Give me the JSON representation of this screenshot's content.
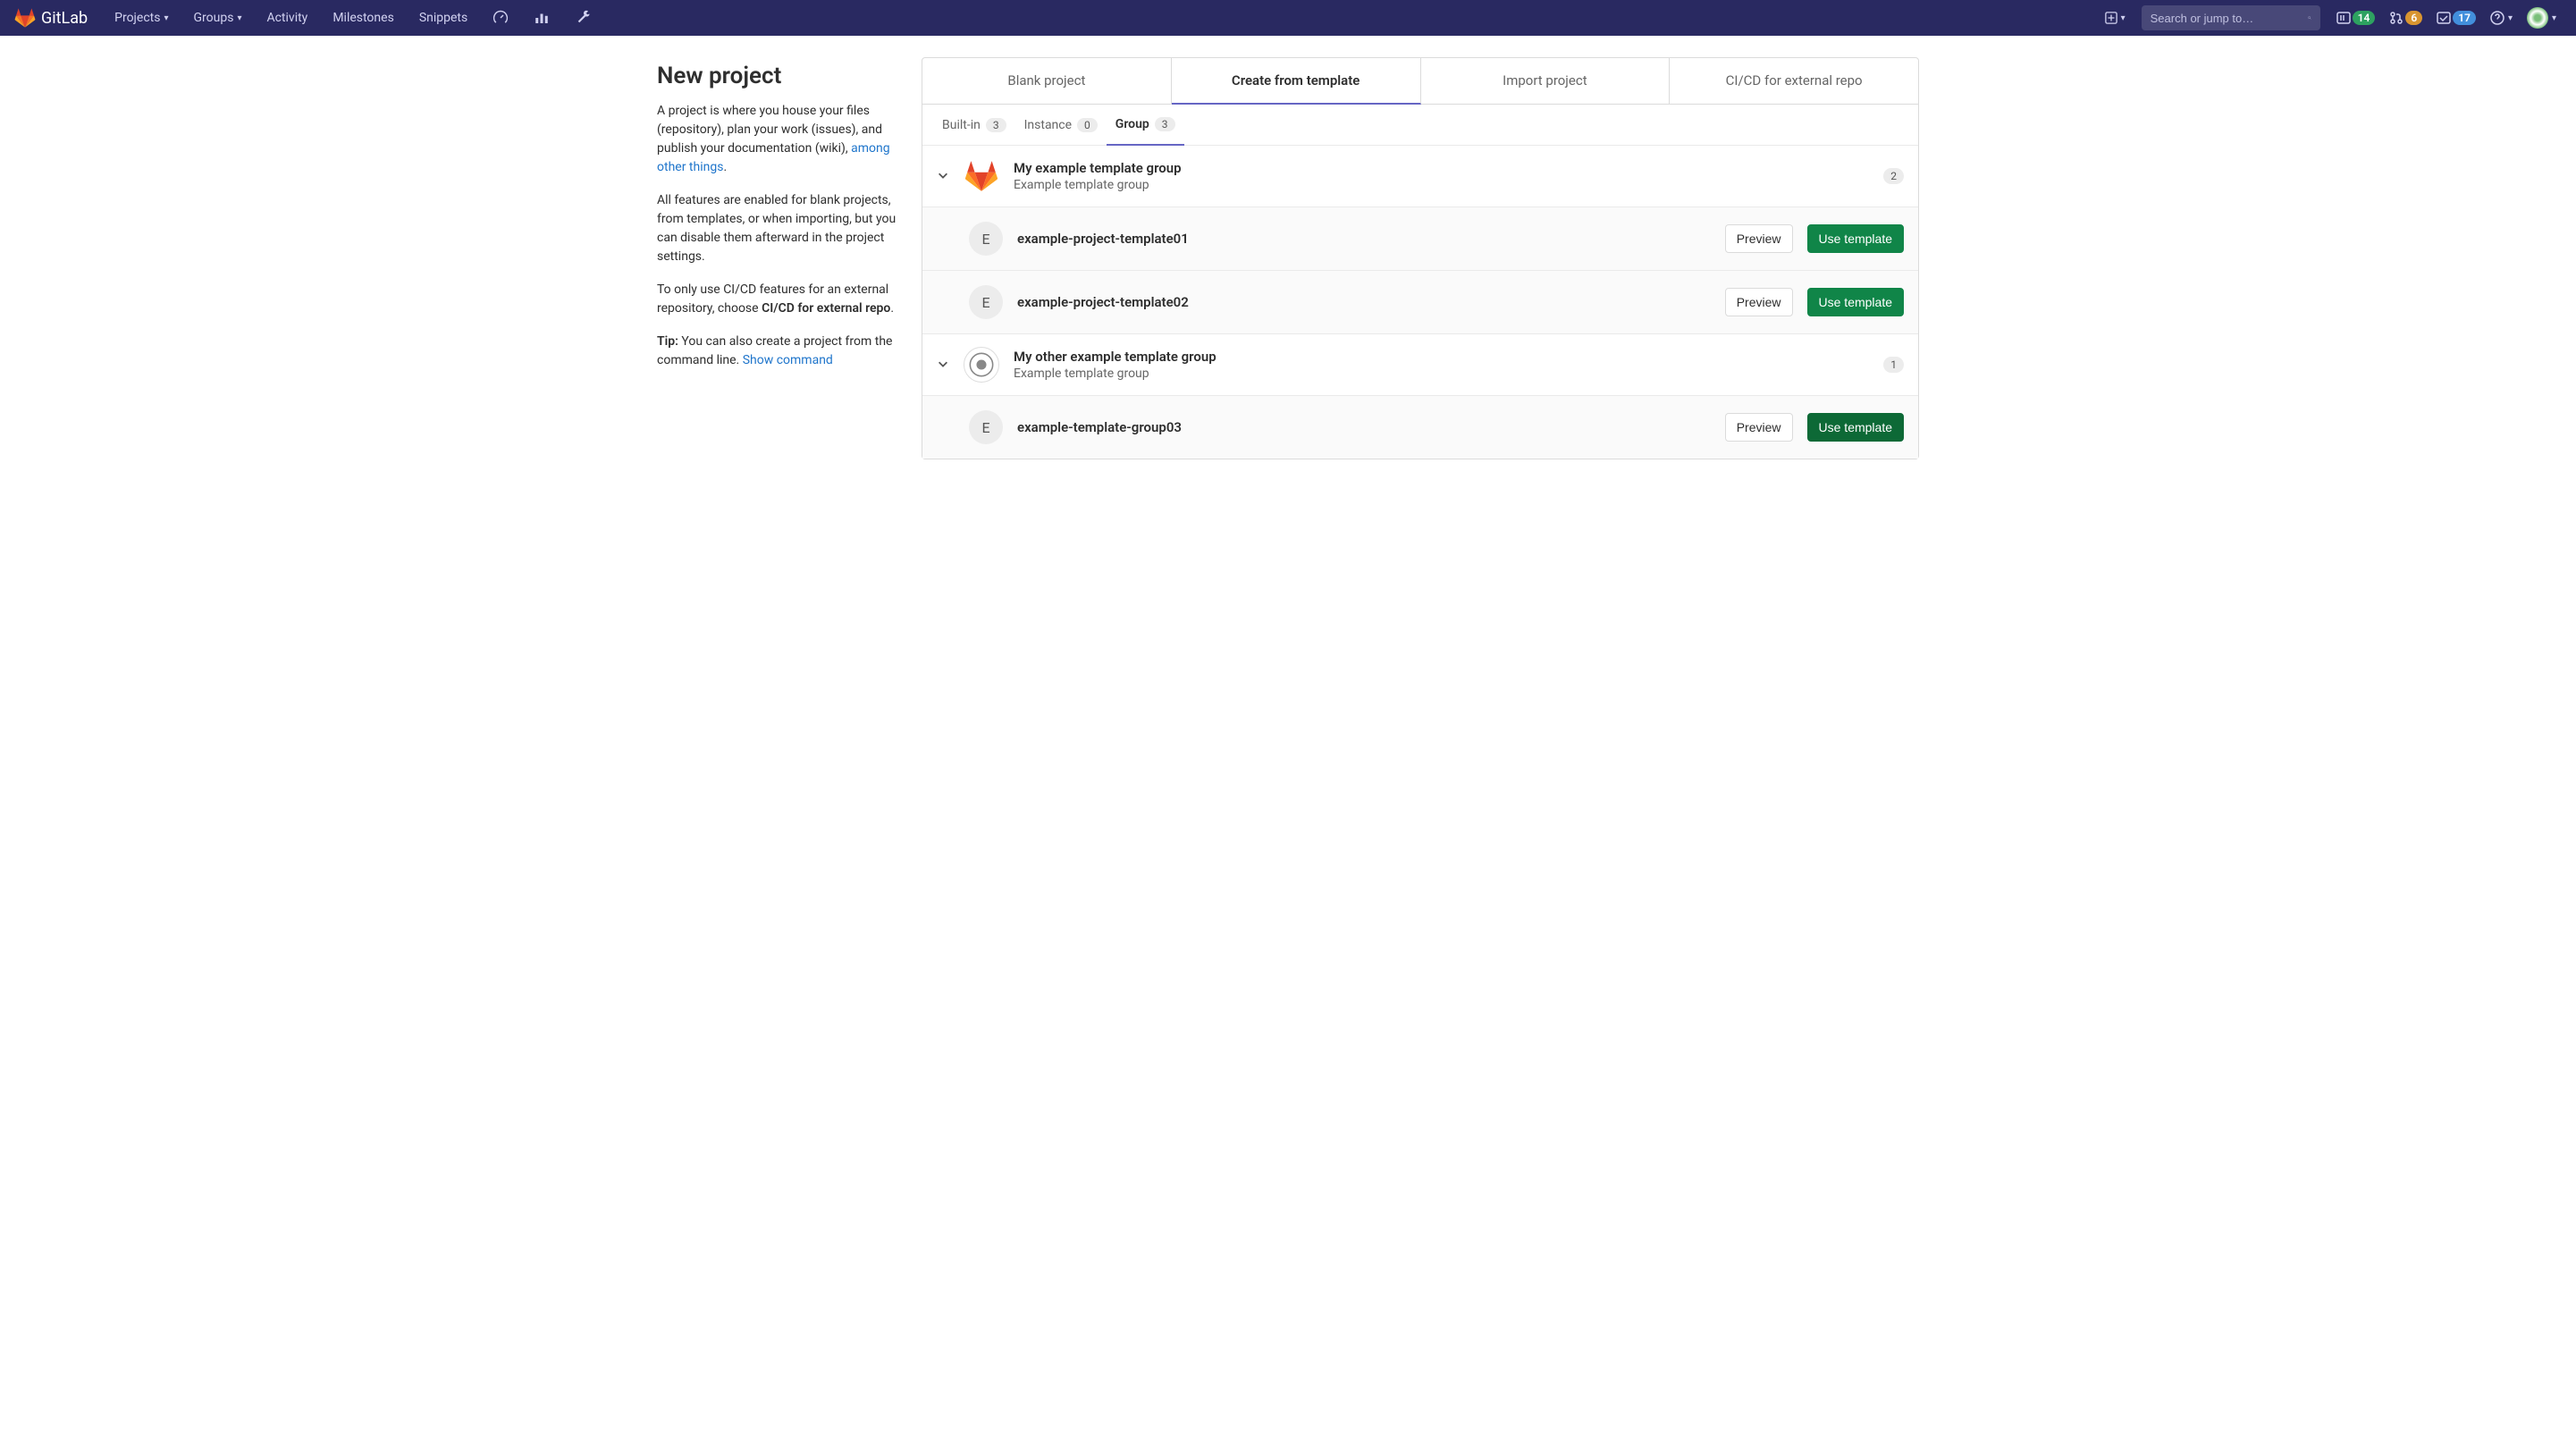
{
  "header": {
    "brand": "GitLab",
    "nav": {
      "projects": "Projects",
      "groups": "Groups",
      "activity": "Activity",
      "milestones": "Milestones",
      "snippets": "Snippets"
    },
    "search_placeholder": "Search or jump to…",
    "badges": {
      "issues": "14",
      "mrs": "6",
      "todos": "17"
    }
  },
  "sidebar": {
    "title": "New project",
    "p1a": "A project is where you house your files (repository), plan your work (issues), and publish your documentation (wiki), ",
    "p1_link": "among other things",
    "p1b": ".",
    "p2": "All features are enabled for blank projects, from templates, or when importing, but you can disable them afterward in the project settings.",
    "p3a": "To only use CI/CD features for an external repository, choose ",
    "p3_strong": "CI/CD for external repo",
    "p3b": ".",
    "p4_strong": "Tip:",
    "p4a": " You can also create a project from the command line. ",
    "p4_link": "Show command"
  },
  "tabs": {
    "blank": "Blank project",
    "template": "Create from template",
    "import": "Import project",
    "cicd": "CI/CD for external repo"
  },
  "subtabs": {
    "builtin": "Built-in",
    "builtin_n": "3",
    "instance": "Instance",
    "instance_n": "0",
    "group": "Group",
    "group_n": "3"
  },
  "groups": [
    {
      "name": "My example template group",
      "desc": "Example template group",
      "count": "2",
      "icon": "gitlab",
      "templates": [
        {
          "letter": "E",
          "name": "example-project-template01"
        },
        {
          "letter": "E",
          "name": "example-project-template02"
        }
      ]
    },
    {
      "name": "My other example template group",
      "desc": "Example template group",
      "count": "1",
      "icon": "circle",
      "templates": [
        {
          "letter": "E",
          "name": "example-template-group03"
        }
      ]
    }
  ],
  "buttons": {
    "preview": "Preview",
    "use": "Use template"
  }
}
